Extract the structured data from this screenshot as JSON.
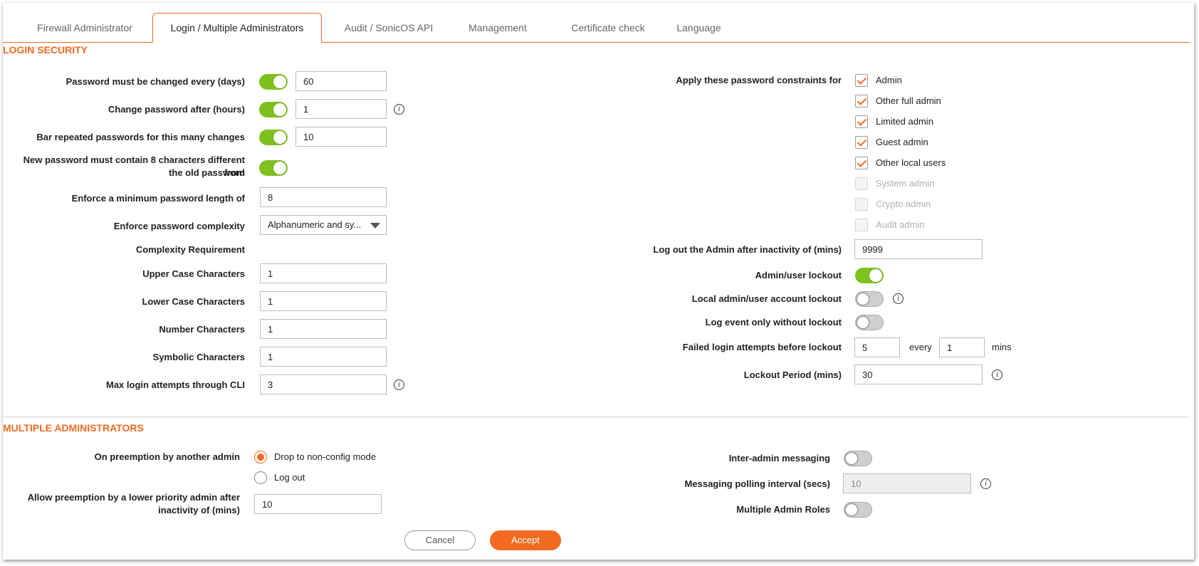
{
  "tabs": [
    {
      "label": "Firewall Administrator"
    },
    {
      "label": "Login / Multiple Administrators"
    },
    {
      "label": "Audit / SonicOS API"
    },
    {
      "label": "Management"
    },
    {
      "label": "Certificate check"
    },
    {
      "label": "Language"
    }
  ],
  "active_tab": "Login / Multiple Administrators",
  "login_security": {
    "title": "LOGIN SECURITY",
    "password_change_days": {
      "label": "Password must be changed every (days)",
      "value": "60",
      "enabled": true
    },
    "change_after_hours": {
      "label": "Change password after (hours)",
      "value": "1",
      "enabled": true
    },
    "bar_repeated": {
      "label": "Bar repeated passwords for this many changes",
      "value": "10",
      "enabled": true
    },
    "new_password_diff": {
      "label_line1": "New password must contain 8 characters different from",
      "label_line2": "the old password",
      "enabled": true
    },
    "min_length": {
      "label": "Enforce a minimum password length of",
      "value": "8"
    },
    "complexity": {
      "label": "Enforce password complexity",
      "value": "Alphanumeric and sy..."
    },
    "complexity_requirement": "Complexity Requirement",
    "upper_case": {
      "label": "Upper Case Characters",
      "value": "1"
    },
    "lower_case": {
      "label": "Lower Case Characters",
      "value": "1"
    },
    "number_chars": {
      "label": "Number Characters",
      "value": "1"
    },
    "symbolic_chars": {
      "label": "Symbolic Characters",
      "value": "1"
    },
    "max_cli_attempts": {
      "label": "Max login attempts through CLI",
      "value": "3"
    },
    "apply_constraints_label": "Apply these password constraints for",
    "constraints": [
      {
        "label": "Admin",
        "checked": true,
        "disabled": false
      },
      {
        "label": "Other full admin",
        "checked": true,
        "disabled": false
      },
      {
        "label": "Limited admin",
        "checked": true,
        "disabled": false
      },
      {
        "label": "Guest admin",
        "checked": true,
        "disabled": false
      },
      {
        "label": "Other local users",
        "checked": true,
        "disabled": false
      },
      {
        "label": "System admin",
        "checked": false,
        "disabled": true
      },
      {
        "label": "Crypto admin",
        "checked": false,
        "disabled": true
      },
      {
        "label": "Audit admin",
        "checked": false,
        "disabled": true
      }
    ],
    "inactivity_logout": {
      "label": "Log out the Admin after inactivity of (mins)",
      "value": "9999"
    },
    "user_lockout": {
      "label": "Admin/user lockout",
      "enabled": true
    },
    "local_lockout": {
      "label": "Local admin/user account lockout",
      "enabled": false
    },
    "log_only": {
      "label": "Log event only without lockout",
      "enabled": false
    },
    "failed_attempts": {
      "label": "Failed login attempts before lockout",
      "value": "5",
      "every_label": "every",
      "every_value": "1",
      "mins_label": "mins"
    },
    "lockout_period": {
      "label": "Lockout Period (mins)",
      "value": "30"
    }
  },
  "multiple_admins": {
    "title": "MULTIPLE ADMINISTRATORS",
    "preemption_label": "On preemption by another admin",
    "preemption_options": [
      {
        "label": "Drop to non-config mode",
        "checked": true
      },
      {
        "label": "Log out",
        "checked": false
      }
    ],
    "allow_preemption": {
      "label_line1": "Allow preemption by a lower priority admin after",
      "label_line2": "inactivity of (mins)",
      "value": "10"
    },
    "inter_admin_messaging": {
      "label": "Inter-admin messaging",
      "enabled": false
    },
    "polling_interval": {
      "label": "Messaging polling interval (secs)",
      "value": "10"
    },
    "multiple_admin_roles": {
      "label": "Multiple Admin Roles",
      "enabled": false
    }
  },
  "buttons": {
    "cancel": "Cancel",
    "accept": "Accept"
  },
  "colors": {
    "accent": "#f26b21",
    "toggle_on": "#7ec11f"
  }
}
